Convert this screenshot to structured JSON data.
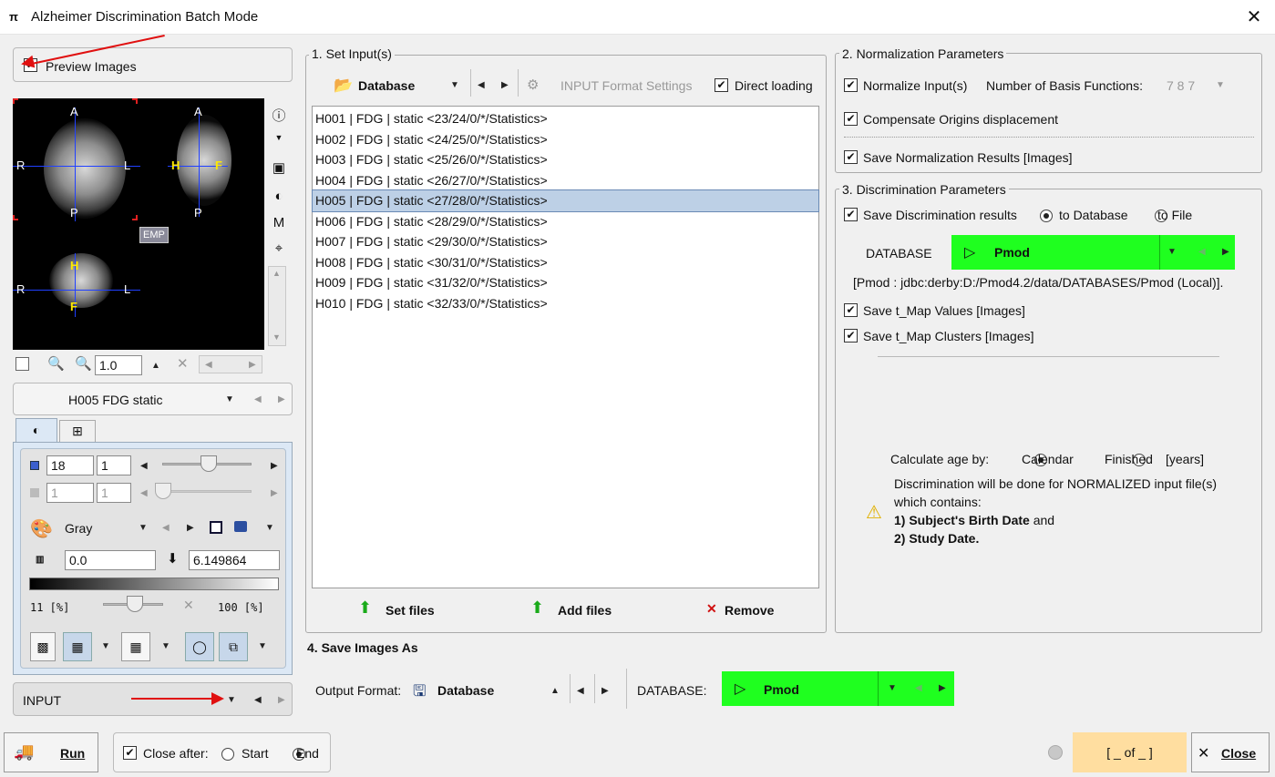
{
  "window": {
    "title": "Alzheimer Discrimination Batch Mode",
    "close_glyph": "✕",
    "app_icon": "π"
  },
  "left": {
    "preview_images_label": "Preview Images",
    "preview_images_checked": true,
    "orient": {
      "a": "A",
      "p": "P",
      "r": "R",
      "l": "L",
      "h": "H",
      "f": "F"
    },
    "emp_label": "EMP",
    "zoom_value": "1.0",
    "series_select": "H005 FDG static",
    "frame_value": "18",
    "frame_step": "1",
    "slice_value": "1",
    "slice_step": "1",
    "colormap": "Gray",
    "min_value": "0.0",
    "max_value": "6.149864",
    "lower_pct": "11  [%]",
    "upper_pct": "100  [%]",
    "bottom_select": "INPUT"
  },
  "set_inputs": {
    "group_label": "1. Set Input(s)",
    "source": "Database",
    "format_settings": "INPUT Format Settings",
    "direct_loading": "Direct loading",
    "direct_loading_checked": true,
    "items": [
      "H001 | FDG | static <23/24/0/*/Statistics>",
      "H002 | FDG | static <24/25/0/*/Statistics>",
      "H003 | FDG | static <25/26/0/*/Statistics>",
      "H004 | FDG | static <26/27/0/*/Statistics>",
      "H005 | FDG | static <27/28/0/*/Statistics>",
      "H006 | FDG | static <28/29/0/*/Statistics>",
      "H007 | FDG | static <29/30/0/*/Statistics>",
      "H008 | FDG | static <30/31/0/*/Statistics>",
      "H009 | FDG | static <31/32/0/*/Statistics>",
      "H010 | FDG | static <32/33/0/*/Statistics>"
    ],
    "selected_index": 4,
    "set_files": "Set files",
    "add_files": "Add files",
    "remove": "Remove"
  },
  "normalization": {
    "group_label": "2. Normalization Parameters",
    "normalize_inputs": "Normalize Input(s)",
    "basis_label": "Number of Basis Functions:",
    "basis_value": "7 8 7",
    "compensate": "Compensate Origins displacement",
    "save_results": "Save Normalization Results [Images]"
  },
  "discrimination": {
    "group_label": "3. Discrimination Parameters",
    "save_results": "Save Discrimination results",
    "to_database": "to Database",
    "to_file": "to File",
    "database_label": "DATABASE",
    "database_value": "Pmod",
    "db_path": "[Pmod : jdbc:derby:D:/Pmod4.2/data/DATABASES/Pmod (Local)].",
    "save_tmap_values": "Save t_Map Values [Images]",
    "save_tmap_clusters": "Save t_Map Clusters [Images]",
    "age_label": "Calculate age by:",
    "calendar": "Calendar",
    "finished": "Finished",
    "years": "[years]",
    "note_line1": "Discrimination will be done for NORMALIZED input file(s)",
    "note_line2": "which contains:",
    "note_item1_bold": "1) Subject's Birth Date",
    "note_item1_rest": " and",
    "note_item2": "2) Study Date."
  },
  "save_images": {
    "group_label": "4. Save Images As",
    "output_format_label": "Output Format:",
    "output_format_value": "Database",
    "database_label": "DATABASE:",
    "database_value": "Pmod"
  },
  "footer": {
    "run": "Run",
    "close_after": "Close after:",
    "start": "Start",
    "end": "End",
    "counter": "[ _ of _ ]",
    "close": "Close"
  },
  "colors": {
    "green": "#1fff1f",
    "selection": "#bdd0e6",
    "counter_bg": "#ffdea0",
    "arrow": "#e01010"
  }
}
